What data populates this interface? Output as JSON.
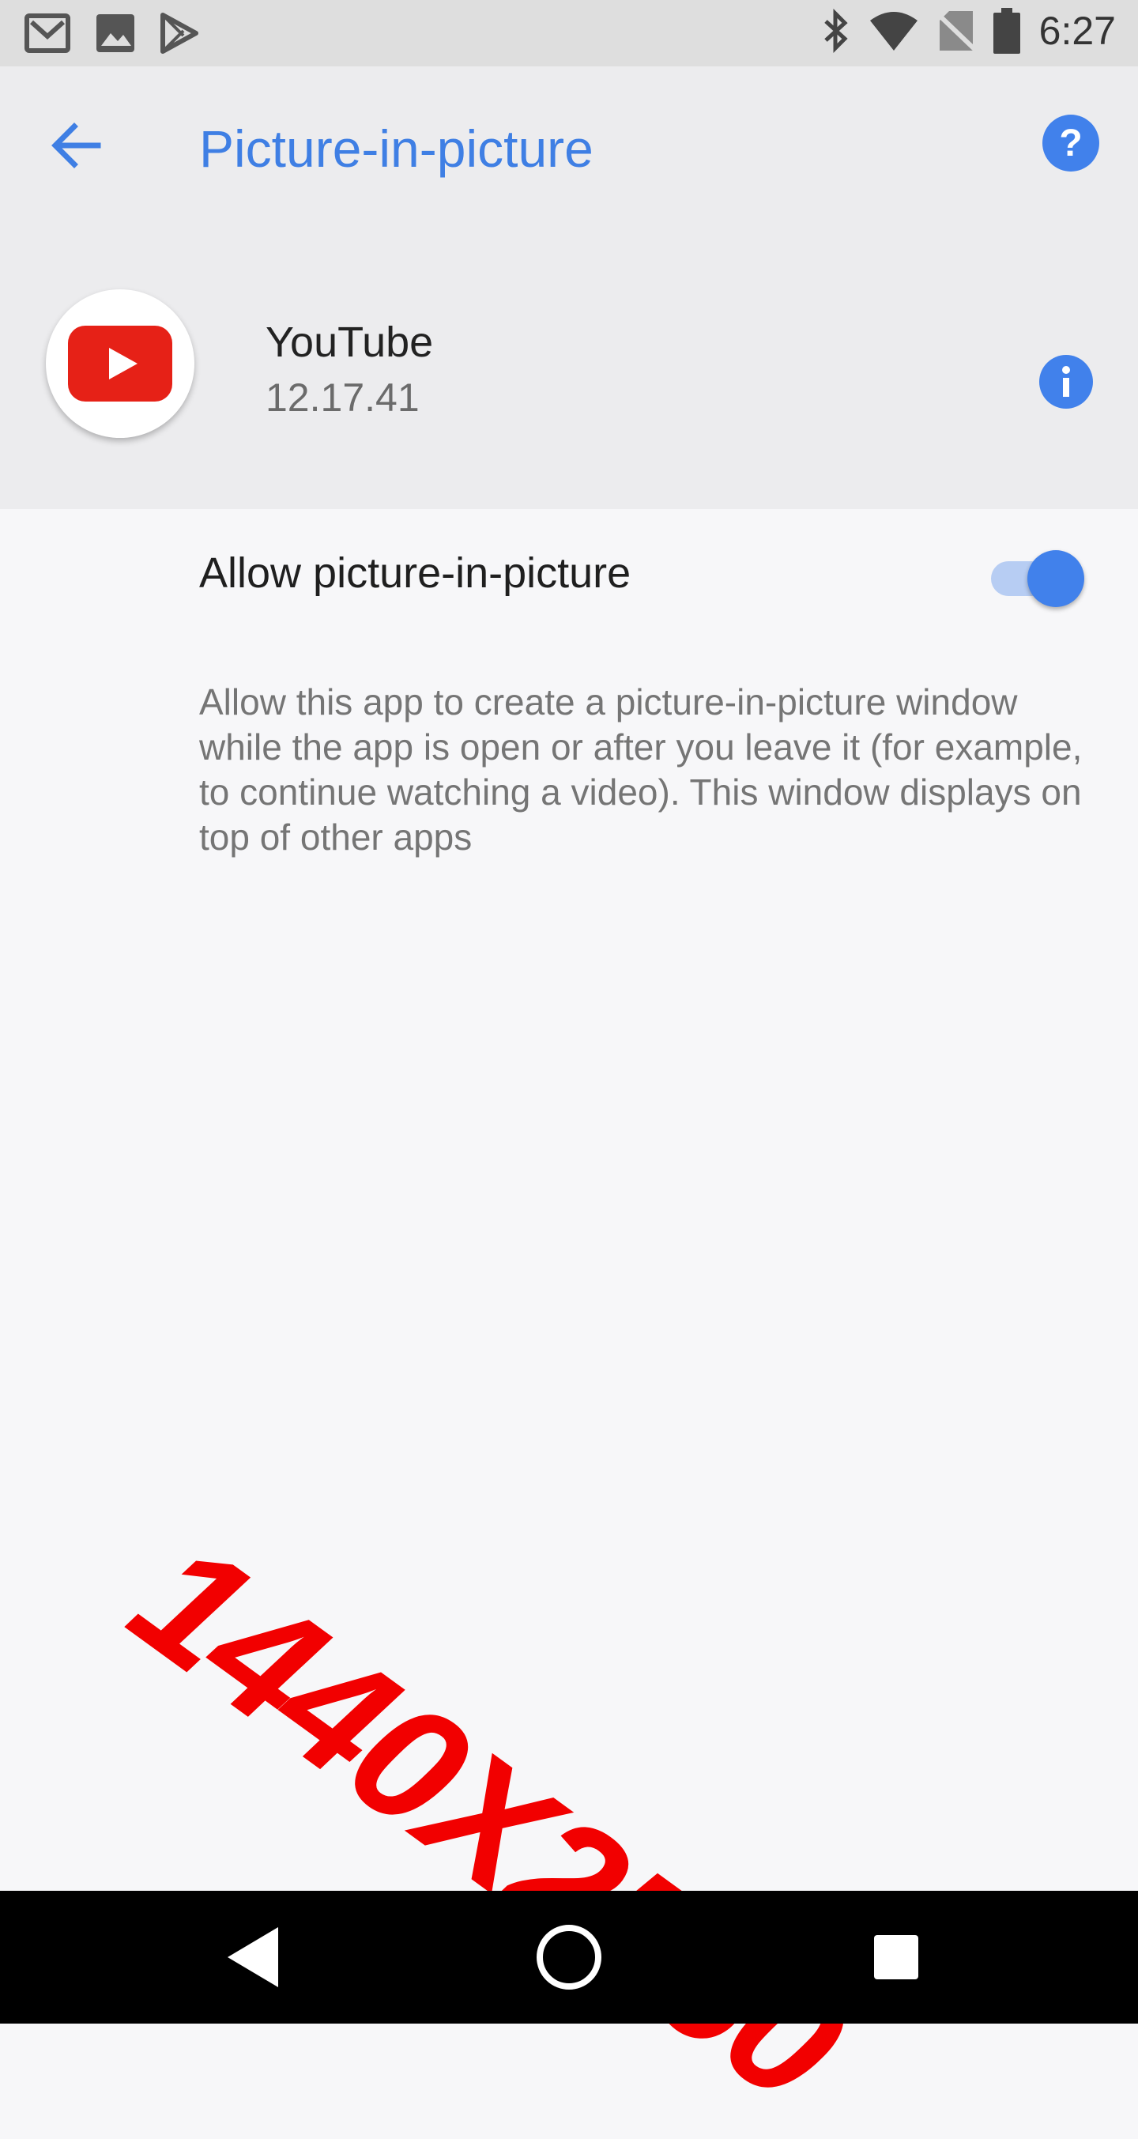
{
  "status_bar": {
    "time": "6:27",
    "left_icons": [
      "gmail-icon",
      "photos-icon",
      "play-store-icon"
    ],
    "right_icons": [
      "bluetooth-icon",
      "wifi-icon",
      "no-sim-icon",
      "battery-icon"
    ]
  },
  "toolbar": {
    "title": "Picture-in-picture",
    "back_icon": "arrow-left-icon",
    "help_icon": "help-icon"
  },
  "app": {
    "name": "YouTube",
    "version": "12.17.41",
    "info_icon": "info-icon"
  },
  "setting": {
    "label": "Allow picture-in-picture",
    "enabled": true,
    "description": "Allow this app to create a picture-in-picture window while the app is open or after you leave it (for example, to continue watching a video). This window displays on top of other apps"
  },
  "watermark": "1440X2560",
  "colors": {
    "accent": "#4181eb",
    "title": "#3f7fe4",
    "youtube_red": "#e62117",
    "watermark": "#f20000"
  },
  "nav_bar": {
    "icons": [
      "back-icon",
      "home-icon",
      "recents-icon"
    ]
  }
}
